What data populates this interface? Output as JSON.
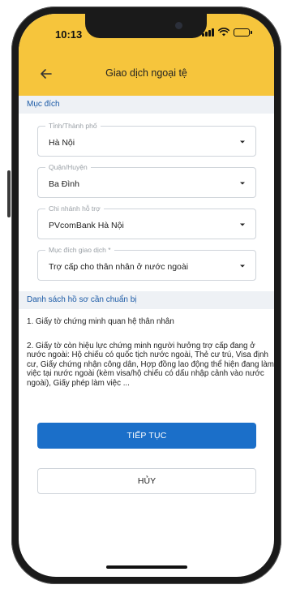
{
  "status_bar": {
    "time": "10:13"
  },
  "header": {
    "title": "Giao dịch ngoại tệ",
    "back_icon": "arrow-left-icon"
  },
  "purpose_section": {
    "title": "Mục đích"
  },
  "fields": {
    "province": {
      "label": "Tỉnh/Thành phố",
      "value": "Hà Nội"
    },
    "district": {
      "label": "Quận/Huyện",
      "value": "Ba Đình"
    },
    "branch": {
      "label": "Chi nhánh hỗ trợ",
      "value": "PVcomBank Hà Nội"
    },
    "purpose": {
      "label": "Mục đích giao dịch *",
      "value": "Trợ cấp cho thân nhân ở nước ngoài"
    }
  },
  "documents_section": {
    "title": "Danh sách hồ sơ cần chuẩn bị",
    "items": [
      "1. Giấy tờ chứng minh quan hệ thân nhân",
      "2. Giấy tờ còn hiệu lực chứng minh người hưởng trợ cấp đang ở nước ngoài: Hộ chiếu có quốc tịch nước ngoài, Thẻ cư trú, Visa định cư, Giấy chứng nhận công dân, Hợp đồng lao động thể hiện đang làm việc tại nước ngoài (kèm visa/hộ chiếu có dấu nhập cảnh vào nước ngoài), Giấy phép làm việc ..."
    ]
  },
  "buttons": {
    "continue": "TIẾP TỤC",
    "cancel": "HỦY"
  },
  "colors": {
    "header": "#f6c53c",
    "accent": "#1b6fc9",
    "section_bg": "#eef1f5"
  }
}
